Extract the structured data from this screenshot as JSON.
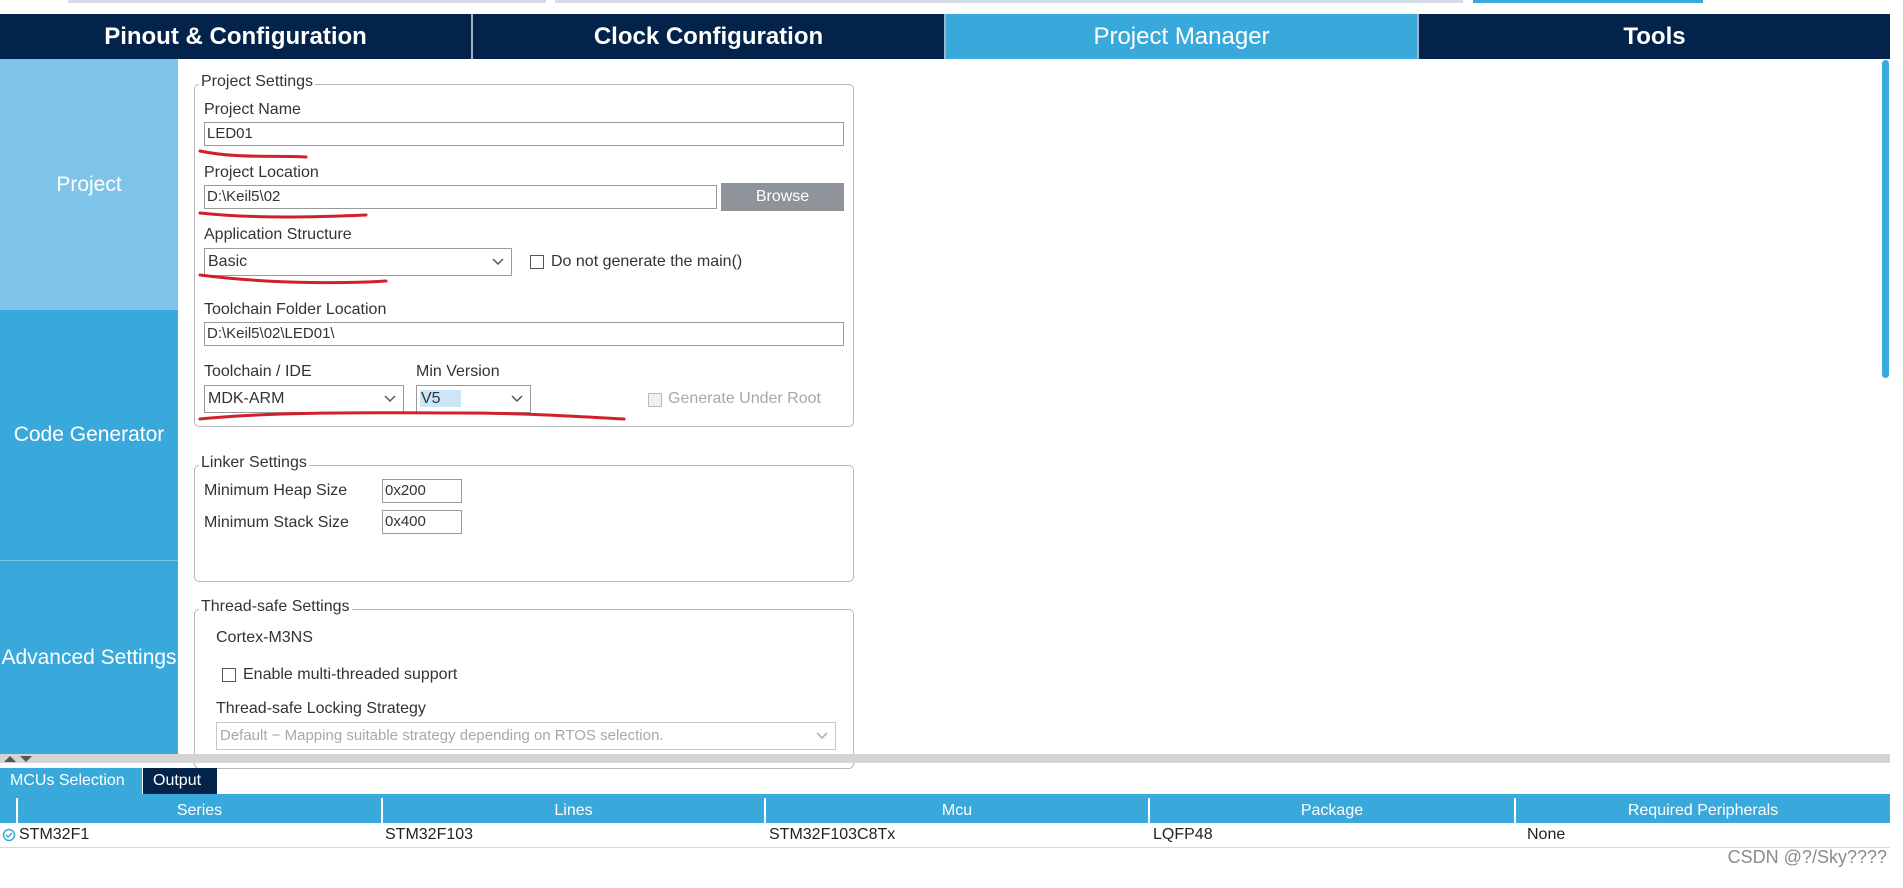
{
  "tabs": [
    {
      "label": "Pinout & Configuration"
    },
    {
      "label": "Clock Configuration"
    },
    {
      "label": "Project Manager"
    },
    {
      "label": "Tools"
    }
  ],
  "sidebar": {
    "items": [
      {
        "label": "Project"
      },
      {
        "label": "Code Generator"
      },
      {
        "label": "Advanced Settings"
      }
    ]
  },
  "project_settings": {
    "title": "Project Settings",
    "project_name_label": "Project Name",
    "project_name_value": "LED01",
    "project_location_label": "Project Location",
    "project_location_value": "D:\\Keil5\\02",
    "browse_label": "Browse",
    "app_structure_label": "Application Structure",
    "app_structure_value": "Basic",
    "do_not_generate_main_label": "Do not generate the main()",
    "toolchain_folder_label": "Toolchain Folder Location",
    "toolchain_folder_value": "D:\\Keil5\\02\\LED01\\",
    "toolchain_ide_label": "Toolchain / IDE",
    "toolchain_ide_value": "MDK-ARM",
    "min_version_label": "Min Version",
    "min_version_value": "V5",
    "generate_under_root_label": "Generate Under Root"
  },
  "linker_settings": {
    "title": "Linker Settings",
    "min_heap_label": "Minimum Heap Size",
    "min_heap_value": "0x200",
    "min_stack_label": "Minimum Stack Size",
    "min_stack_value": "0x400"
  },
  "thread_safe_settings": {
    "title": "Thread-safe Settings",
    "core_label": "Cortex-M3NS",
    "enable_multithread_label": "Enable multi-threaded support",
    "locking_strategy_label": "Thread-safe Locking Strategy",
    "locking_strategy_value": "Default  −  Mapping suitable strategy depending on RTOS selection."
  },
  "bottom_tabs": [
    {
      "label": "MCUs Selection"
    },
    {
      "label": "Output"
    }
  ],
  "table": {
    "headers": [
      "Series",
      "Lines",
      "Mcu",
      "Package",
      "Required Peripherals"
    ],
    "rows": [
      [
        "STM32F1",
        "STM32F103",
        "STM32F103C8Tx",
        "LQFP48",
        "None"
      ]
    ]
  },
  "watermark": "CSDN @?/Sky????",
  "colors": {
    "tab_dark": "#03234b",
    "accent": "#39a9dc",
    "sidebar_selected": "#7ec3e8",
    "annotation_red": "#d0202a"
  }
}
